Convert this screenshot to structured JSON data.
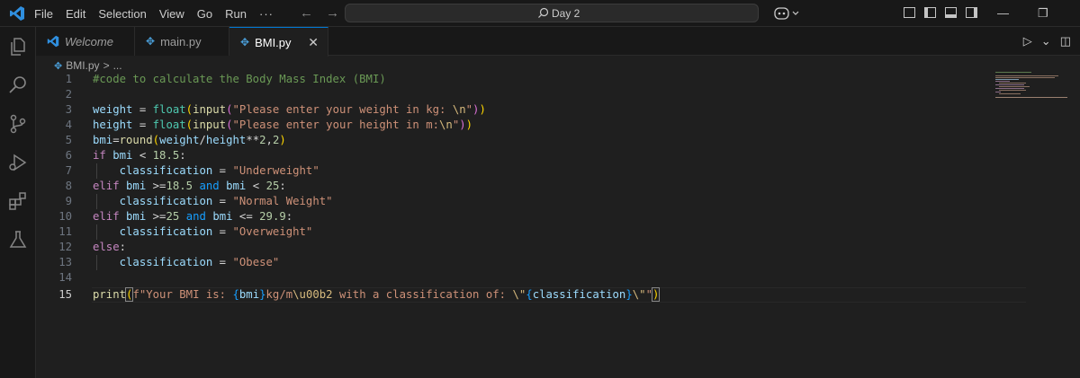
{
  "menu": [
    "File",
    "Edit",
    "Selection",
    "View",
    "Go",
    "Run",
    "···"
  ],
  "search": {
    "text": "Day 2",
    "icon": "search-icon"
  },
  "nav": {
    "back": "←",
    "forward": "→"
  },
  "window_controls": {
    "minimize": "—",
    "restore": "❐",
    "close": "✕"
  },
  "tabs": [
    {
      "label": "Welcome",
      "icon": "vscode-icon",
      "active": false
    },
    {
      "label": "main.py",
      "icon": "python-icon",
      "active": false
    },
    {
      "label": "BMI.py",
      "icon": "python-icon",
      "active": true,
      "close": "✕"
    }
  ],
  "tab_actions": {
    "run": "▷",
    "run_menu": "⌄",
    "split": "◫",
    "more": "···"
  },
  "breadcrumb": {
    "file": "BMI.py",
    "sep": ">",
    "rest": "..."
  },
  "editor": {
    "current_line": 15,
    "line_numbers": [
      "1",
      "2",
      "3",
      "4",
      "5",
      "6",
      "7",
      "8",
      "9",
      "10",
      "11",
      "12",
      "13",
      "14",
      "15"
    ]
  },
  "colors": {
    "accent": "#0078d4",
    "background": "#1f1f1f",
    "sidebar": "#181818"
  }
}
